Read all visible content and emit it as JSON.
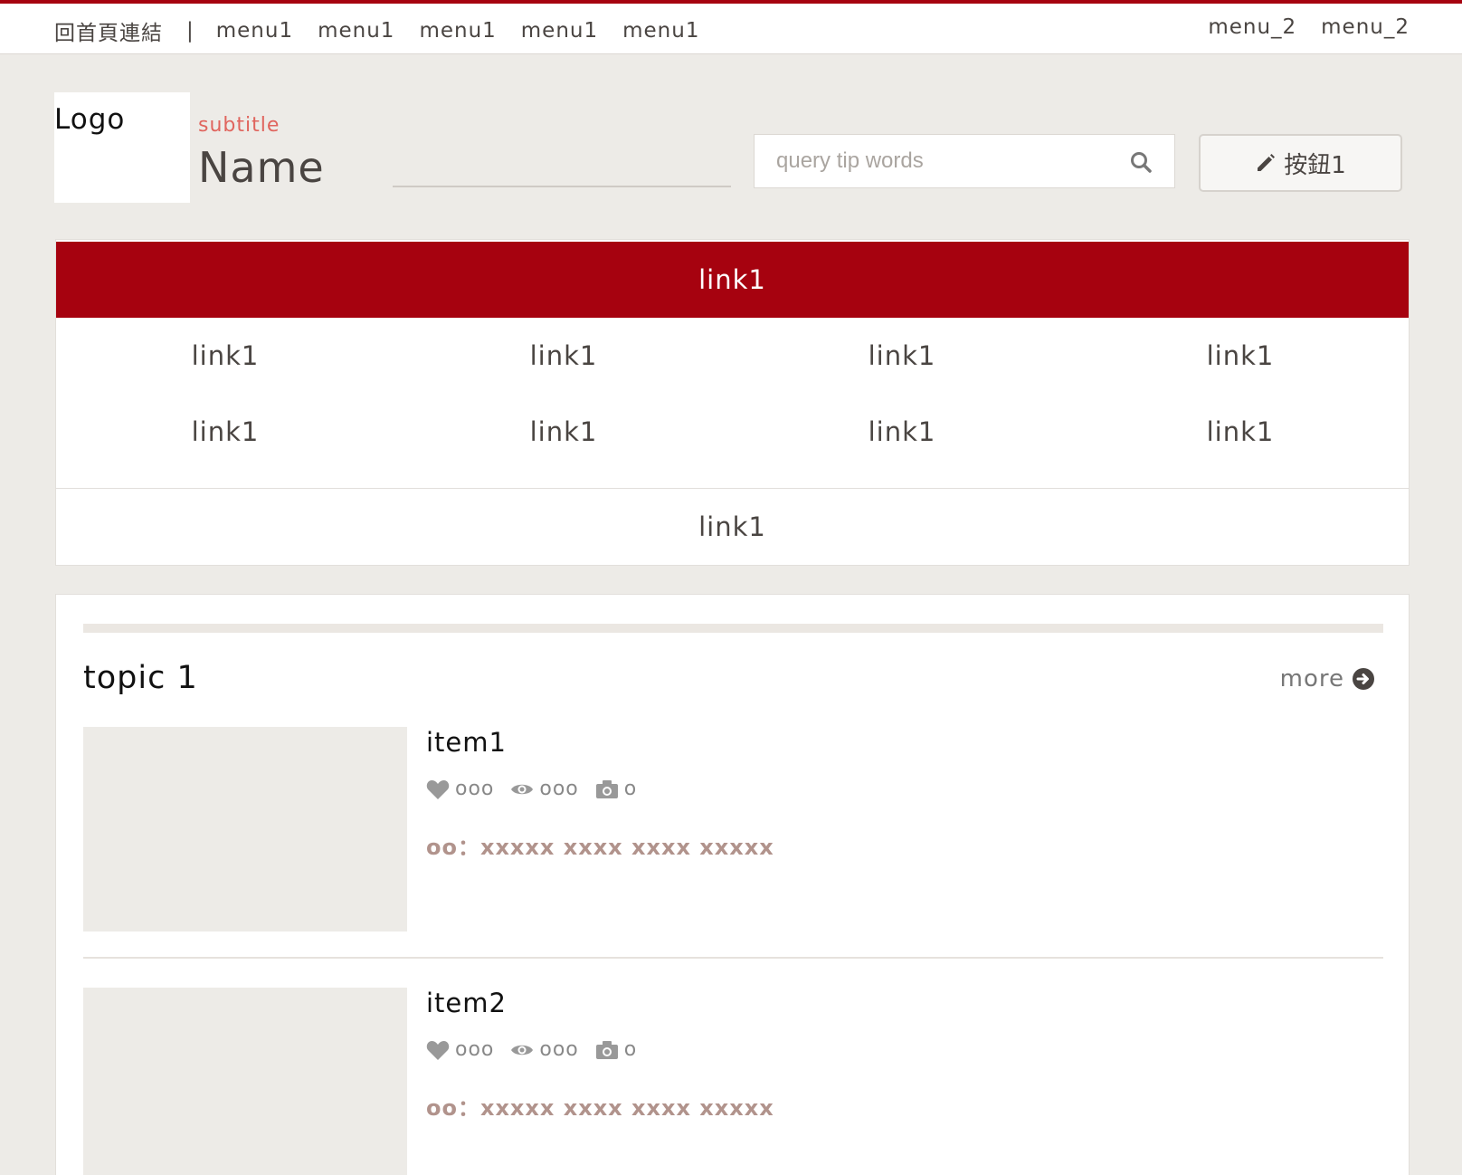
{
  "topnav": {
    "home_label": "回首頁連結",
    "separator": "|",
    "menu1": [
      "menu1",
      "menu1",
      "menu1",
      "menu1",
      "menu1"
    ],
    "menu2": [
      "menu_2",
      "menu_2"
    ]
  },
  "header": {
    "logo": "Logo",
    "subtitle": "subtitle",
    "name": "Name",
    "search_placeholder": "query tip words",
    "search_icon": "search-icon",
    "button_label": "按鈕1",
    "button_icon": "pencil-icon"
  },
  "links": {
    "feature": "link1",
    "grid": [
      "link1",
      "link1",
      "link1",
      "link1",
      "link1",
      "link1",
      "link1",
      "link1"
    ],
    "bottom": "link1"
  },
  "topic": {
    "title": "topic 1",
    "more_label": "more",
    "more_icon": "arrow-circle-right-icon",
    "items": [
      {
        "name": "item1",
        "likes": "ooo",
        "views": "ooo",
        "photos": "o",
        "desc": "oo：xxxxx xxxx xxxx xxxxx"
      },
      {
        "name": "item2",
        "likes": "ooo",
        "views": "ooo",
        "photos": "o",
        "desc": "oo：xxxxx xxxx xxxx xxxxx"
      }
    ]
  },
  "colors": {
    "accent": "#a6020f",
    "background": "#edebe7",
    "subtitle": "#e0655e",
    "desc": "#b1938c"
  }
}
